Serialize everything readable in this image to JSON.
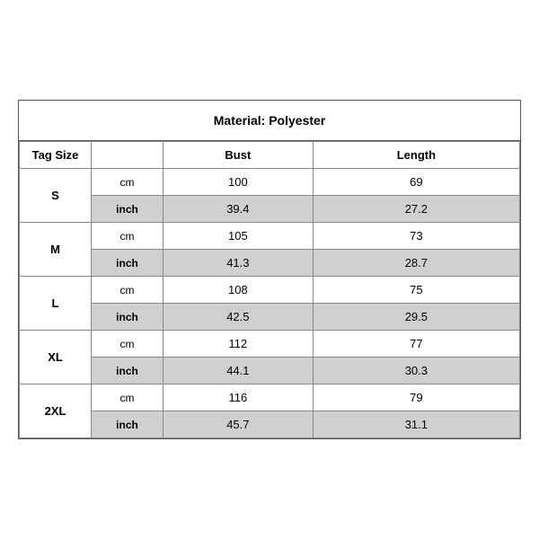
{
  "title": "Material: Polyester",
  "headers": {
    "tag_size": "Tag Size",
    "bust": "Bust",
    "length": "Length"
  },
  "sizes": [
    {
      "tag": "S",
      "cm": {
        "bust": "100",
        "length": "69"
      },
      "inch": {
        "bust": "39.4",
        "length": "27.2"
      }
    },
    {
      "tag": "M",
      "cm": {
        "bust": "105",
        "length": "73"
      },
      "inch": {
        "bust": "41.3",
        "length": "28.7"
      }
    },
    {
      "tag": "L",
      "cm": {
        "bust": "108",
        "length": "75"
      },
      "inch": {
        "bust": "42.5",
        "length": "29.5"
      }
    },
    {
      "tag": "XL",
      "cm": {
        "bust": "112",
        "length": "77"
      },
      "inch": {
        "bust": "44.1",
        "length": "30.3"
      }
    },
    {
      "tag": "2XL",
      "cm": {
        "bust": "116",
        "length": "79"
      },
      "inch": {
        "bust": "45.7",
        "length": "31.1"
      }
    }
  ]
}
